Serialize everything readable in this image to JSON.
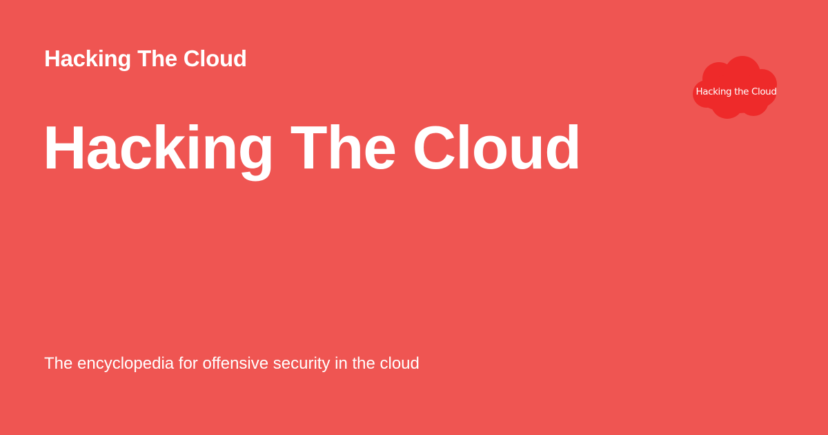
{
  "site": {
    "name": "Hacking The Cloud"
  },
  "page": {
    "title": "Hacking The Cloud",
    "description": "The encyclopedia for offensive security in the cloud"
  },
  "logo": {
    "icon": "cloud-icon",
    "text": "Hacking the Cloud",
    "color": "#ee2a2a"
  },
  "colors": {
    "background": "#ef5552",
    "text": "#ffffff"
  }
}
